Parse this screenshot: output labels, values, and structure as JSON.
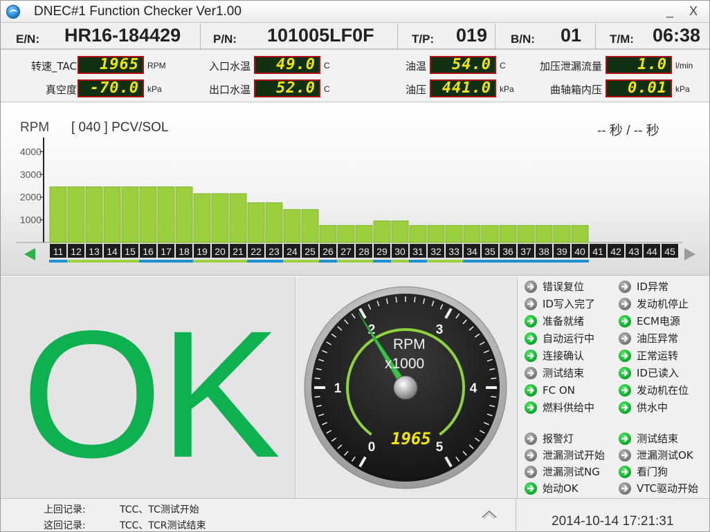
{
  "window": {
    "title": "DNEC#1 Function Checker Ver1.00",
    "min_label": "_",
    "close_label": "X"
  },
  "info": {
    "en_label": "E/N:",
    "en_value": "HR16-184429",
    "pn_label": "P/N:",
    "pn_value": "101005LF0F",
    "tp_label": "T/P:",
    "tp_value": "019",
    "bn_label": "B/N:",
    "bn_value": "01",
    "tm_label": "T/M:",
    "tm_value": "06:38"
  },
  "sensors": [
    {
      "label": "转速_TAC",
      "value": "1965",
      "unit": "RPM"
    },
    {
      "label": "入口水温",
      "value": "49.0",
      "unit": "C"
    },
    {
      "label": "油温",
      "value": "54.0",
      "unit": "C"
    },
    {
      "label": "加压泄漏流量",
      "value": "1.0",
      "unit": "l/min"
    },
    {
      "label": "真空度",
      "value": "-70.0",
      "unit": "kPa"
    },
    {
      "label": "出口水温",
      "value": "52.0",
      "unit": "C"
    },
    {
      "label": "油压",
      "value": "441.0",
      "unit": "kPa"
    },
    {
      "label": "曲轴箱内压",
      "value": "0.01",
      "unit": "kPa"
    }
  ],
  "chart": {
    "unit_label": "RPM",
    "step_label": "[ 040 ] PCV/SOL",
    "time_label": "-- 秒 / -- 秒",
    "bar_color": "#9ccf3e",
    "left_arrow_color": "#2fb14a",
    "right_arrow_color": "#9a9a9a"
  },
  "chart_data": {
    "type": "bar",
    "ylim": [
      0,
      4500
    ],
    "ytick_labels": [
      "1000",
      "2000",
      "3000",
      "4000"
    ],
    "yticks": [
      1000,
      2000,
      3000,
      4000
    ],
    "categories": [
      "11",
      "12",
      "13",
      "14",
      "15",
      "16",
      "17",
      "18",
      "19",
      "20",
      "21",
      "22",
      "23",
      "24",
      "25",
      "26",
      "27",
      "28",
      "29",
      "30",
      "31",
      "32",
      "33",
      "34",
      "35",
      "36",
      "37",
      "38",
      "39",
      "40",
      "41",
      "42",
      "43",
      "44",
      "45"
    ],
    "values": [
      2450,
      2450,
      2450,
      2450,
      2450,
      2450,
      2450,
      2450,
      2150,
      2150,
      2150,
      1750,
      1750,
      1450,
      1450,
      750,
      750,
      750,
      950,
      950,
      750,
      750,
      750,
      750,
      750,
      750,
      750,
      750,
      750,
      750,
      0,
      0,
      0,
      0,
      0
    ],
    "group_underline_colors": [
      "#1a8fd4",
      "#9ccf3e",
      "#9ccf3e",
      "#9ccf3e",
      "#9ccf3e",
      "#1a8fd4",
      "#1a8fd4",
      "#1a8fd4",
      "#9ccf3e",
      "#9ccf3e",
      "#9ccf3e",
      "#1a8fd4",
      "#1a8fd4",
      "#9ccf3e",
      "#9ccf3e",
      "#1a8fd4",
      "#9ccf3e",
      "#9ccf3e",
      "#1a8fd4",
      "#9ccf3e",
      "#1a8fd4",
      "#9ccf3e",
      "#9ccf3e",
      "#1a8fd4",
      "#1a8fd4",
      "#1a8fd4",
      "#1a8fd4",
      "#1a8fd4",
      "#1a8fd4",
      "#1a8fd4",
      "",
      "",
      "",
      "",
      ""
    ]
  },
  "main": {
    "result_text": "OK",
    "result_color": "#0db150"
  },
  "gauge": {
    "label_unit": "RPM",
    "label_mult": "x1000",
    "digital_value": "1965",
    "needle_value": 1.965,
    "ticks": [
      "0",
      "1",
      "2",
      "3",
      "4",
      "5"
    ],
    "arc_color": "#8fd33b",
    "needle_color": "#3ec24e"
  },
  "status": [
    {
      "label": "错误复位",
      "on": false
    },
    {
      "label": "ID异常",
      "on": false
    },
    {
      "label": "ID写入完了",
      "on": false
    },
    {
      "label": "发动机停止",
      "on": false
    },
    {
      "label": "准备就绪",
      "on": true
    },
    {
      "label": "ECM电源",
      "on": true
    },
    {
      "label": "自动运行中",
      "on": true
    },
    {
      "label": "油压异常",
      "on": false
    },
    {
      "label": "连接确认",
      "on": true
    },
    {
      "label": "正常运转",
      "on": true
    },
    {
      "label": "测试结束",
      "on": false
    },
    {
      "label": "ID已读入",
      "on": true
    },
    {
      "label": "FC ON",
      "on": true
    },
    {
      "label": "发动机在位",
      "on": true
    },
    {
      "label": "燃料供给中",
      "on": true
    },
    {
      "label": "供水中",
      "on": true
    }
  ],
  "status2": [
    {
      "label": "报警灯",
      "on": false
    },
    {
      "label": "测试结束",
      "on": true
    },
    {
      "label": "泄漏测试开始",
      "on": false
    },
    {
      "label": "泄漏测试OK",
      "on": false
    },
    {
      "label": "泄漏测试NG",
      "on": false
    },
    {
      "label": "看门狗",
      "on": true
    },
    {
      "label": "始动OK",
      "on": true
    },
    {
      "label": "VTC驱动开始",
      "on": false
    }
  ],
  "footer": {
    "last_label": "上回记录:",
    "last_value": "TCC、TC测试开始",
    "this_label": "这回记录:",
    "this_value": "TCC、TCR测试结束",
    "datetime": "2014-10-14 17:21:31"
  }
}
